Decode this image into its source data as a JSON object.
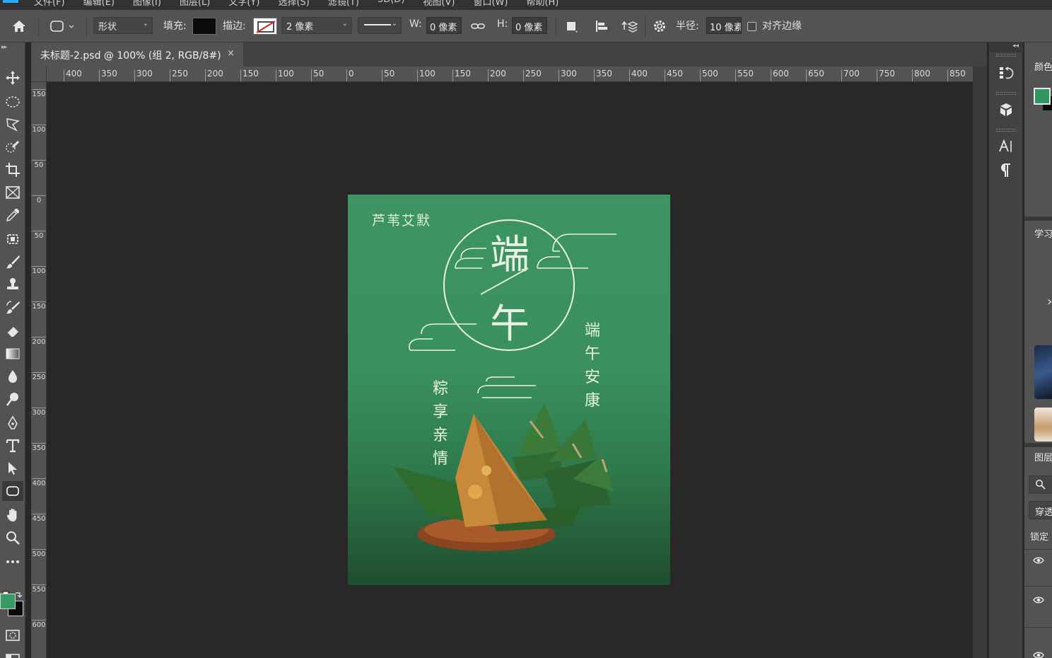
{
  "menubar": {
    "items": [
      "文件(F)",
      "编辑(E)",
      "图像(I)",
      "图层(L)",
      "文字(Y)",
      "选择(S)",
      "滤镜(T)",
      "3D(D)",
      "视图(V)",
      "窗口(W)",
      "帮助(H)"
    ]
  },
  "options_bar": {
    "mode_label": "形状",
    "fill_label": "填充:",
    "stroke_label": "描边:",
    "stroke_width": "2 像素",
    "w_label": "W:",
    "w_value": "0 像素",
    "h_label": "H:",
    "h_value": "0 像素",
    "radius_label": "半径:",
    "radius_value": "10 像素",
    "align_edges_label": "对齐边缘",
    "align_edges_checked": false,
    "fill_color": "#0a0a0a"
  },
  "document": {
    "tab_title": "未标题-2.psd @ 100% (组 2, RGB/8#)",
    "close_glyph": "×"
  },
  "rulers": {
    "top": [
      "400",
      "350",
      "300",
      "250",
      "200",
      "150",
      "100",
      "50",
      "0",
      "50",
      "100",
      "150",
      "200",
      "250",
      "300",
      "350",
      "400",
      "450",
      "500",
      "550",
      "600",
      "650",
      "700",
      "750",
      "800",
      "850"
    ],
    "left": [
      "150",
      "100",
      "50",
      "0",
      "50",
      "100",
      "150",
      "200",
      "250",
      "300",
      "350",
      "400",
      "450",
      "500",
      "550",
      "600"
    ]
  },
  "colors": {
    "foreground": "#3a9a66",
    "background": "#0a0a0a",
    "art_green": "#3d9563",
    "panel_swatch": "#2f9660"
  },
  "artwork": {
    "brand": "芦苇艾默",
    "big_char_1": "端",
    "big_char_2": "午",
    "vertical_right": "端午安康",
    "vertical_left": "粽享亲情"
  },
  "right_panels": {
    "color_title": "颜色",
    "learn_title": "学习",
    "layers_title": "图层",
    "layer_mode": "穿透",
    "lock_label": "锁定"
  }
}
